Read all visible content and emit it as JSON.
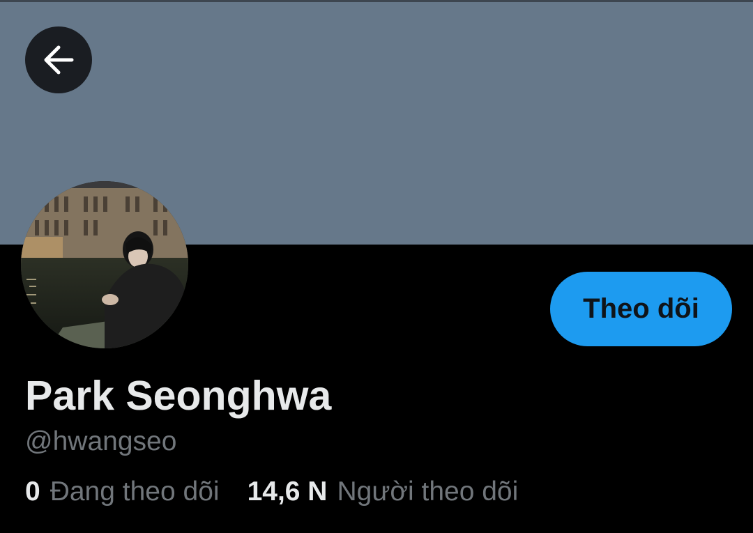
{
  "colors": {
    "banner": "#66788a",
    "background": "#000000",
    "accent": "#1d9bf0",
    "primary_text": "#e7e9ea",
    "secondary_text": "#71767b"
  },
  "header": {
    "back_icon": "arrow-left-icon"
  },
  "profile": {
    "display_name": "Park Seonghwa",
    "handle": "@hwangseo",
    "follow_label": "Theo dõi"
  },
  "stats": {
    "following_count": "0",
    "following_label": "Đang theo dõi",
    "followers_count": "14,6 N",
    "followers_label": "Người theo dõi"
  }
}
